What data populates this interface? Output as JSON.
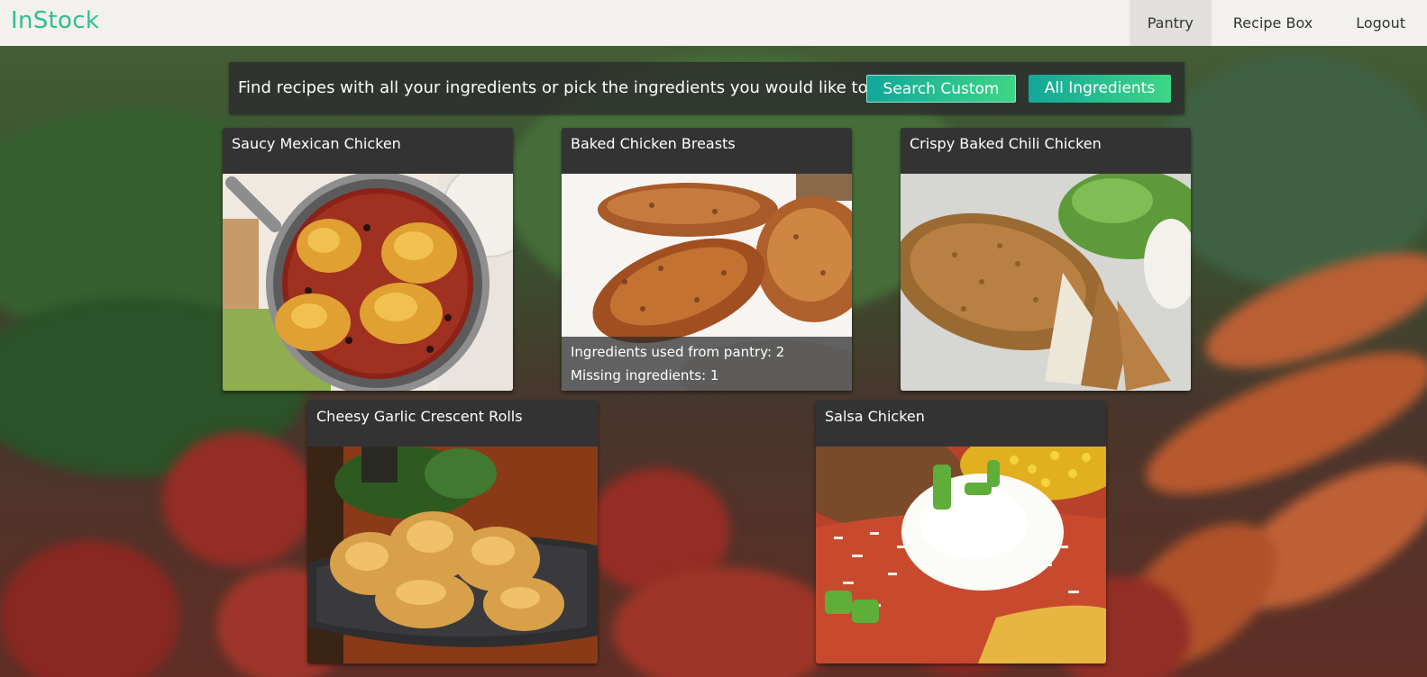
{
  "app": {
    "brand": "InStock"
  },
  "nav": {
    "items": [
      {
        "label": "Pantry",
        "active": true
      },
      {
        "label": "Recipe Box",
        "active": false
      },
      {
        "label": "Logout",
        "active": false
      }
    ]
  },
  "banner": {
    "text": "Find recipes with all your ingredients or pick the ingredients you would like to use!",
    "search_custom_label": "Search Custom",
    "all_ingredients_label": "All Ingredients"
  },
  "colors": {
    "brand": "#2bbf93",
    "button_start": "#12a79a",
    "button_end": "#3ed686"
  },
  "recipes": [
    {
      "title": "Saucy Mexican Chicken"
    },
    {
      "title": "Baked Chicken Breasts",
      "used_label": "Ingredients used from pantry: 2",
      "missing_label": "Missing ingredients: 1"
    },
    {
      "title": "Crispy Baked Chili Chicken"
    },
    {
      "title": "Cheesy Garlic Crescent Rolls"
    },
    {
      "title": "Salsa Chicken"
    }
  ]
}
